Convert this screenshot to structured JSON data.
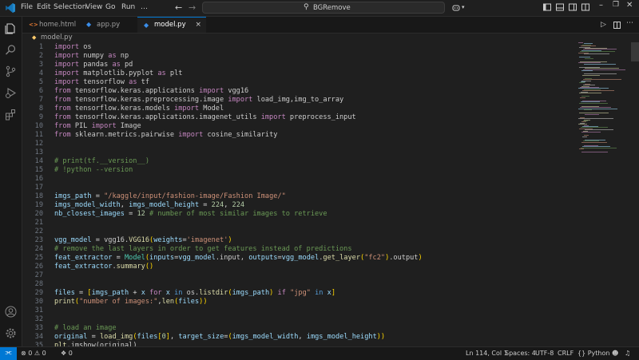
{
  "menu": [
    "File",
    "Edit",
    "Selection",
    "View",
    "Go",
    "Run",
    "…"
  ],
  "search": {
    "text": "BGRemove"
  },
  "tabs": [
    {
      "label": "home.html",
      "icon": "<>",
      "color": "#e37933"
    },
    {
      "label": "app.py",
      "icon": "◆",
      "color": "#3b8eea"
    },
    {
      "label": "model.py",
      "icon": "◆",
      "color": "#3b8eea",
      "close": "×"
    }
  ],
  "breadcrumb": {
    "file": "model.py"
  },
  "code": {
    "lines": [
      {
        "n": "1",
        "t": [
          [
            "kw",
            "import"
          ],
          [
            "id",
            " os"
          ]
        ]
      },
      {
        "n": "2",
        "t": [
          [
            "kw",
            "import"
          ],
          [
            "id",
            " numpy "
          ],
          [
            "kw",
            "as"
          ],
          [
            "id",
            " np"
          ]
        ]
      },
      {
        "n": "3",
        "t": [
          [
            "kw",
            "import"
          ],
          [
            "id",
            " pandas "
          ],
          [
            "kw",
            "as"
          ],
          [
            "id",
            " pd"
          ]
        ]
      },
      {
        "n": "4",
        "t": [
          [
            "kw",
            "import"
          ],
          [
            "id",
            " matplotlib.pyplot "
          ],
          [
            "kw",
            "as"
          ],
          [
            "id",
            " plt"
          ]
        ]
      },
      {
        "n": "5",
        "t": [
          [
            "kw",
            "import"
          ],
          [
            "id",
            " tensorflow "
          ],
          [
            "kw",
            "as"
          ],
          [
            "id",
            " tf"
          ]
        ]
      },
      {
        "n": "6",
        "t": [
          [
            "kw",
            "from"
          ],
          [
            "id",
            " tensorflow.keras.applications "
          ],
          [
            "kw",
            "import"
          ],
          [
            "id",
            " vgg16"
          ]
        ]
      },
      {
        "n": "7",
        "t": [
          [
            "kw",
            "from"
          ],
          [
            "id",
            " tensorflow.keras.preprocessing.image "
          ],
          [
            "kw",
            "import"
          ],
          [
            "id",
            " load_img,img_to_array"
          ]
        ]
      },
      {
        "n": "8",
        "t": [
          [
            "kw",
            "from"
          ],
          [
            "id",
            " tensorflow.keras.models "
          ],
          [
            "kw",
            "import"
          ],
          [
            "id",
            " Model"
          ]
        ]
      },
      {
        "n": "9",
        "t": [
          [
            "kw",
            "from"
          ],
          [
            "id",
            " tensorflow.keras.applications.imagenet_utils "
          ],
          [
            "kw",
            "import"
          ],
          [
            "id",
            " preprocess_input"
          ]
        ]
      },
      {
        "n": "10",
        "t": [
          [
            "kw",
            "from"
          ],
          [
            "id",
            " PIL "
          ],
          [
            "kw",
            "import"
          ],
          [
            "id",
            " Image"
          ]
        ]
      },
      {
        "n": "11",
        "t": [
          [
            "kw",
            "from"
          ],
          [
            "id",
            " sklearn.metrics.pairwise "
          ],
          [
            "kw",
            "import"
          ],
          [
            "id",
            " cosine_similarity"
          ]
        ]
      },
      {
        "n": "12",
        "t": []
      },
      {
        "n": "13",
        "t": []
      },
      {
        "n": "14",
        "t": [
          [
            "cm",
            "# print(tf.__version__)"
          ]
        ]
      },
      {
        "n": "15",
        "t": [
          [
            "cm",
            "# !python --version"
          ]
        ]
      },
      {
        "n": "16",
        "t": []
      },
      {
        "n": "17",
        "t": []
      },
      {
        "n": "18",
        "t": [
          [
            "var",
            "imgs_path"
          ],
          [
            "op",
            " = "
          ],
          [
            "str",
            "\"/kaggle/input/fashion-image/Fashion Image/\""
          ]
        ]
      },
      {
        "n": "19",
        "t": [
          [
            "var",
            "imgs_model_width"
          ],
          [
            "op",
            ", "
          ],
          [
            "var",
            "imgs_model_height"
          ],
          [
            "op",
            " = "
          ],
          [
            "num",
            "224"
          ],
          [
            "op",
            ", "
          ],
          [
            "num",
            "224"
          ]
        ]
      },
      {
        "n": "20",
        "t": [
          [
            "var",
            "nb_closest_images"
          ],
          [
            "op",
            " = "
          ],
          [
            "num",
            "12"
          ],
          [
            "cm",
            " # number of most similar images to retrieve"
          ]
        ]
      },
      {
        "n": "21",
        "t": []
      },
      {
        "n": "22",
        "t": []
      },
      {
        "n": "23",
        "t": [
          [
            "var",
            "vgg_model"
          ],
          [
            "op",
            " = "
          ],
          [
            "id",
            "vgg16."
          ],
          [
            "fn",
            "VGG16"
          ],
          [
            "par",
            "("
          ],
          [
            "var",
            "weights"
          ],
          [
            "op",
            "="
          ],
          [
            "str",
            "'imagenet'"
          ],
          [
            "par",
            ")"
          ]
        ]
      },
      {
        "n": "24",
        "t": [
          [
            "cm",
            "# remove the last layers in order to get features instead of predictions"
          ]
        ]
      },
      {
        "n": "25",
        "t": [
          [
            "var",
            "feat_extractor"
          ],
          [
            "op",
            " = "
          ],
          [
            "cls",
            "Model"
          ],
          [
            "par",
            "("
          ],
          [
            "var",
            "inputs"
          ],
          [
            "op",
            "="
          ],
          [
            "var",
            "vgg_model"
          ],
          [
            "id",
            ".input, "
          ],
          [
            "var",
            "outputs"
          ],
          [
            "op",
            "="
          ],
          [
            "var",
            "vgg_model"
          ],
          [
            "id",
            "."
          ],
          [
            "fn",
            "get_layer"
          ],
          [
            "par",
            "("
          ],
          [
            "str",
            "\"fc2\""
          ],
          [
            "par",
            ")"
          ],
          [
            "id",
            ".output"
          ],
          [
            "par",
            ")"
          ]
        ]
      },
      {
        "n": "26",
        "t": [
          [
            "var",
            "feat_extractor"
          ],
          [
            "id",
            "."
          ],
          [
            "fn",
            "summary"
          ],
          [
            "par",
            "()"
          ]
        ]
      },
      {
        "n": "27",
        "t": []
      },
      {
        "n": "28",
        "t": []
      },
      {
        "n": "29",
        "t": [
          [
            "var",
            "files"
          ],
          [
            "op",
            " = "
          ],
          [
            "par",
            "["
          ],
          [
            "var",
            "imgs_path"
          ],
          [
            "op",
            " + "
          ],
          [
            "var",
            "x"
          ],
          [
            "kw",
            " for "
          ],
          [
            "var",
            "x"
          ],
          [
            "bl",
            " in "
          ],
          [
            "id",
            "os."
          ],
          [
            "fn",
            "listdir"
          ],
          [
            "par",
            "("
          ],
          [
            "var",
            "imgs_path"
          ],
          [
            "par",
            ")"
          ],
          [
            "kw",
            " if "
          ],
          [
            "str",
            "\"jpg\""
          ],
          [
            "bl",
            " in "
          ],
          [
            "var",
            "x"
          ],
          [
            "par",
            "]"
          ]
        ]
      },
      {
        "n": "30",
        "t": [
          [
            "fn",
            "print"
          ],
          [
            "par",
            "("
          ],
          [
            "str",
            "\"number of images:\""
          ],
          [
            "op",
            ","
          ],
          [
            "fn",
            "len"
          ],
          [
            "par",
            "("
          ],
          [
            "var",
            "files"
          ],
          [
            "par",
            "))"
          ]
        ]
      },
      {
        "n": "31",
        "t": []
      },
      {
        "n": "32",
        "t": []
      },
      {
        "n": "33",
        "t": [
          [
            "cm",
            "# load an image"
          ]
        ]
      },
      {
        "n": "34",
        "t": [
          [
            "var",
            "original"
          ],
          [
            "op",
            " = "
          ],
          [
            "fn",
            "load_img"
          ],
          [
            "par",
            "("
          ],
          [
            "var",
            "files"
          ],
          [
            "par",
            "["
          ],
          [
            "num",
            "0"
          ],
          [
            "par",
            "]"
          ],
          [
            "op",
            ", "
          ],
          [
            "var",
            "target_size"
          ],
          [
            "op",
            "="
          ],
          [
            "par",
            "("
          ],
          [
            "var",
            "imgs_model_width"
          ],
          [
            "op",
            ", "
          ],
          [
            "var",
            "imgs_model_height"
          ],
          [
            "par",
            "))"
          ]
        ]
      },
      {
        "n": "35",
        "t": [
          [
            "fn",
            "plt"
          ],
          [
            "id",
            ".imshow(original)"
          ]
        ]
      }
    ]
  },
  "status": {
    "remote": "⫘",
    "errors": "0",
    "warnings": "0",
    "ports": "0",
    "cursor": "Ln 114, Col 1",
    "spaces": "Spaces: 4",
    "encoding": "UTF-8",
    "eol": "CRLF",
    "language": "Python"
  },
  "colors": {
    "accent": "#0078d4",
    "background": "#1f1f1f"
  },
  "icons": [
    "vscode-logo",
    "explorer-icon",
    "search-icon",
    "source-control-icon",
    "run-debug-icon",
    "extensions-icon",
    "account-icon",
    "settings-gear-icon",
    "copilot-icon",
    "layout-icon",
    "run-icon",
    "split-editor-icon",
    "more-icon"
  ]
}
